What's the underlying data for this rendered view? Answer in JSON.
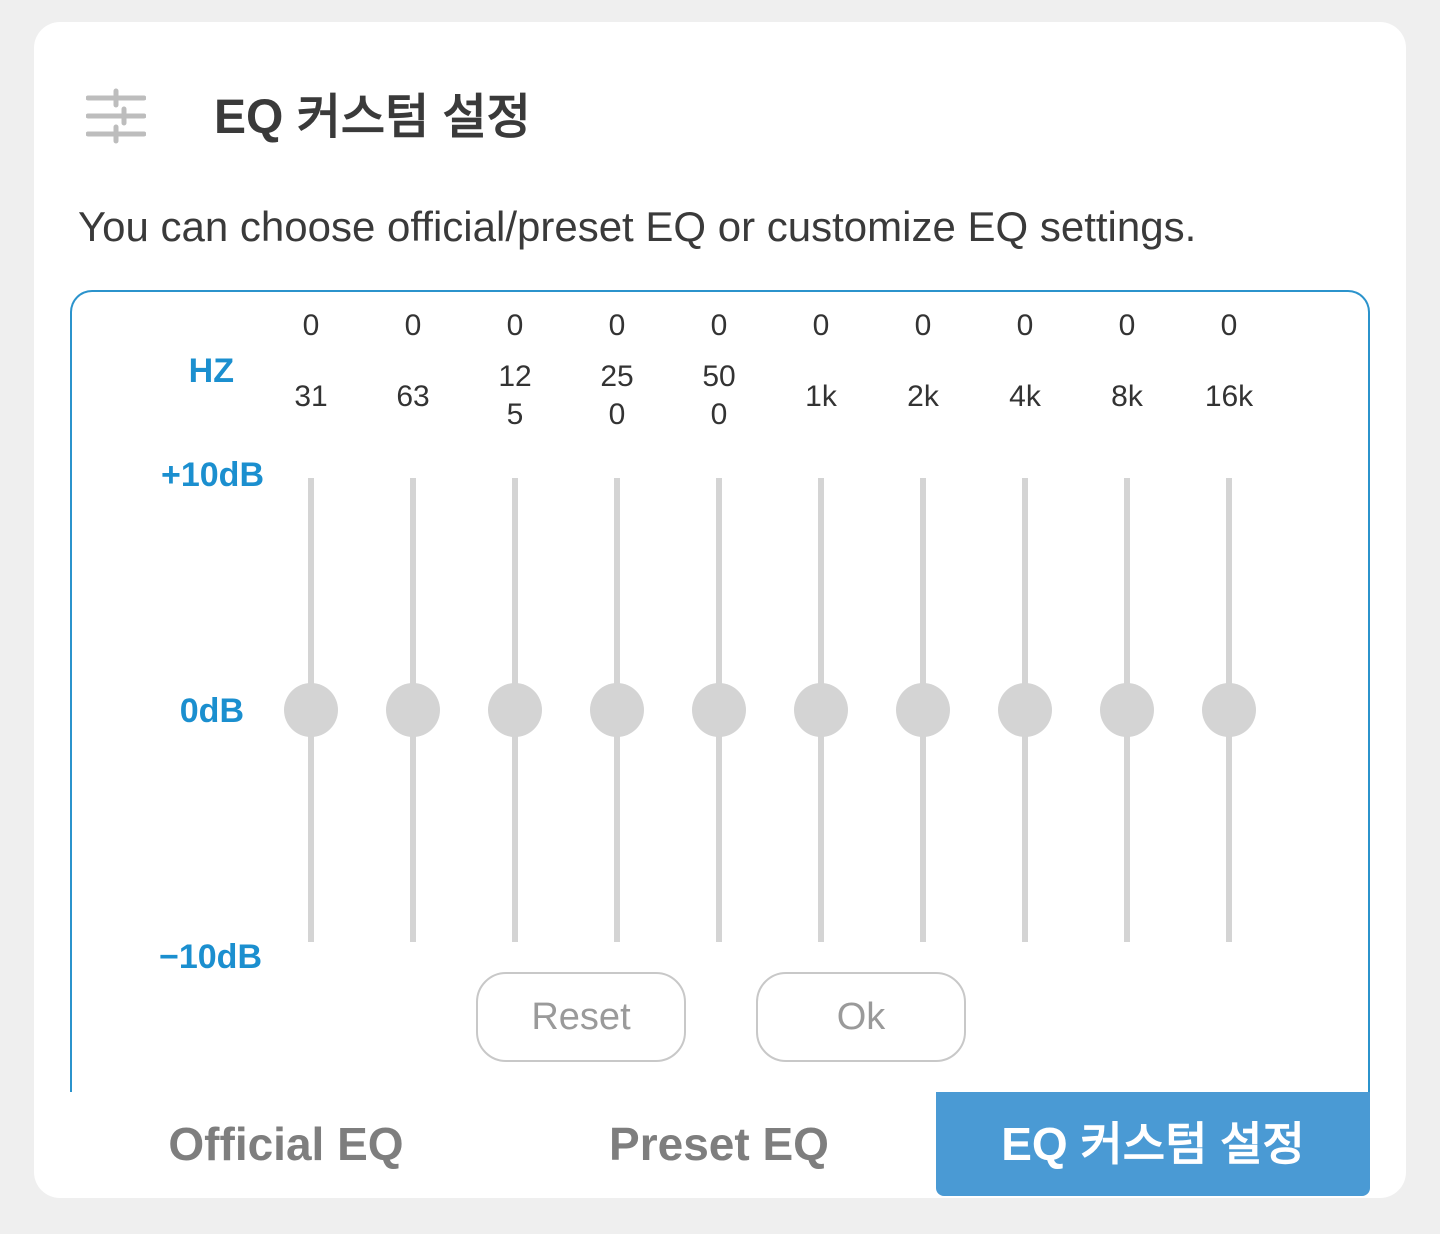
{
  "header": {
    "title": "EQ 커스텀 설정",
    "icon": "sliders-icon"
  },
  "description": "You can choose official/preset EQ or customize EQ settings.",
  "equalizer": {
    "hz_label": "HZ",
    "db_max_label": "+10dB",
    "db_mid_label": "0dB",
    "db_min_label": "−10dB",
    "bands": [
      {
        "gain": "0",
        "freq_line1": "31",
        "freq_line2": "",
        "value_db": 0
      },
      {
        "gain": "0",
        "freq_line1": "63",
        "freq_line2": "",
        "value_db": 0
      },
      {
        "gain": "0",
        "freq_line1": "12",
        "freq_line2": "5",
        "value_db": 0
      },
      {
        "gain": "0",
        "freq_line1": "25",
        "freq_line2": "0",
        "value_db": 0
      },
      {
        "gain": "0",
        "freq_line1": "50",
        "freq_line2": "0",
        "value_db": 0
      },
      {
        "gain": "0",
        "freq_line1": "1k",
        "freq_line2": "",
        "value_db": 0
      },
      {
        "gain": "0",
        "freq_line1": "2k",
        "freq_line2": "",
        "value_db": 0
      },
      {
        "gain": "0",
        "freq_line1": "4k",
        "freq_line2": "",
        "value_db": 0
      },
      {
        "gain": "0",
        "freq_line1": "8k",
        "freq_line2": "",
        "value_db": 0
      },
      {
        "gain": "0",
        "freq_line1": "16k",
        "freq_line2": "",
        "value_db": 0
      }
    ],
    "range_db": [
      -10,
      10
    ]
  },
  "buttons": {
    "reset": "Reset",
    "ok": "Ok"
  },
  "tabs": [
    {
      "label": "Official EQ",
      "active": false
    },
    {
      "label": "Preset EQ",
      "active": false
    },
    {
      "label": "EQ 커스텀 설정",
      "active": true
    }
  ],
  "colors": {
    "accent": "#2b93cc",
    "active_tab": "#4a9ad4",
    "slider": "#d4d4d4"
  }
}
